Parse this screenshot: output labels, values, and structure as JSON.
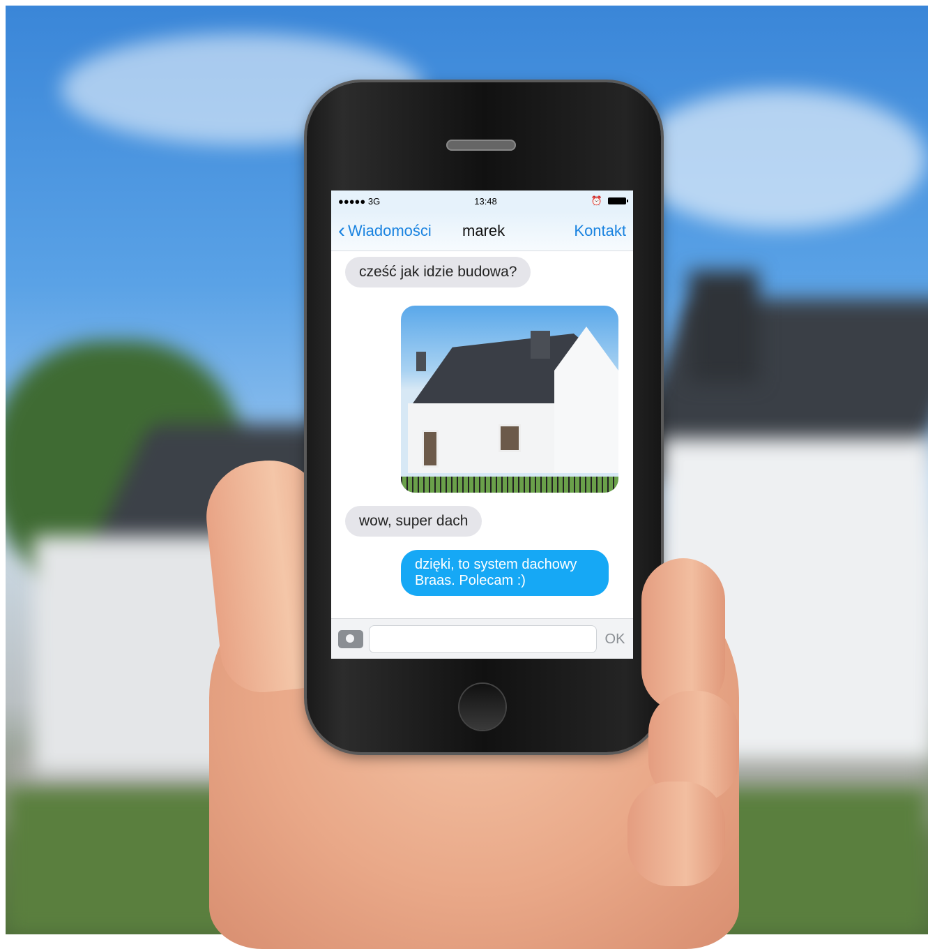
{
  "status": {
    "signal": "●●●●● 3G",
    "time": "13:48"
  },
  "nav": {
    "back_label": "Wiadomości",
    "title": "marek",
    "contact_label": "Kontakt"
  },
  "messages": [
    {
      "direction": "incoming",
      "text": "cześć jak idzie budowa?"
    },
    {
      "direction": "outgoing",
      "type": "photo",
      "icon": "house-photo"
    },
    {
      "direction": "incoming",
      "text": "wow, super dach"
    },
    {
      "direction": "outgoing",
      "text": "dzięki, to system dachowy Braas. Polecam :)"
    }
  ],
  "input": {
    "placeholder": "",
    "send_label": "OK"
  },
  "colors": {
    "accent": "#1a83e0",
    "outgoing_bubble": "#16a8f5",
    "incoming_bubble": "#e5e5ea"
  }
}
